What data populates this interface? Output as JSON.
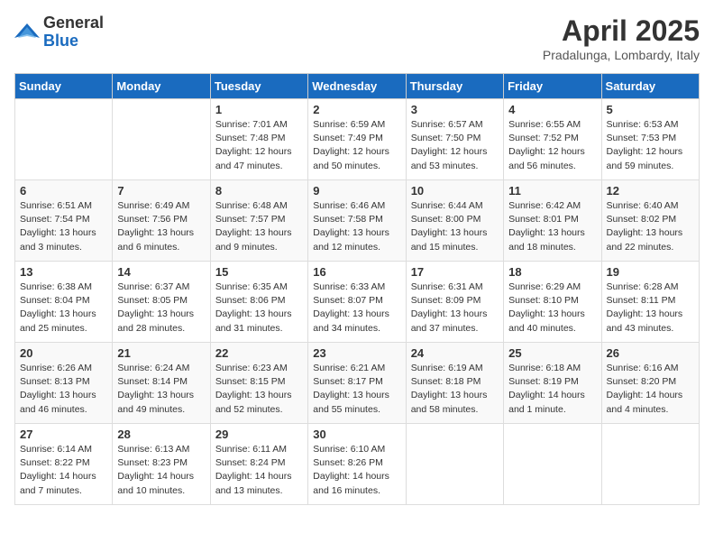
{
  "logo": {
    "general": "General",
    "blue": "Blue"
  },
  "title": "April 2025",
  "subtitle": "Pradalunga, Lombardy, Italy",
  "days_header": [
    "Sunday",
    "Monday",
    "Tuesday",
    "Wednesday",
    "Thursday",
    "Friday",
    "Saturday"
  ],
  "weeks": [
    [
      {
        "day": "",
        "sunrise": "",
        "sunset": "",
        "daylight": ""
      },
      {
        "day": "",
        "sunrise": "",
        "sunset": "",
        "daylight": ""
      },
      {
        "day": "1",
        "sunrise": "Sunrise: 7:01 AM",
        "sunset": "Sunset: 7:48 PM",
        "daylight": "Daylight: 12 hours and 47 minutes."
      },
      {
        "day": "2",
        "sunrise": "Sunrise: 6:59 AM",
        "sunset": "Sunset: 7:49 PM",
        "daylight": "Daylight: 12 hours and 50 minutes."
      },
      {
        "day": "3",
        "sunrise": "Sunrise: 6:57 AM",
        "sunset": "Sunset: 7:50 PM",
        "daylight": "Daylight: 12 hours and 53 minutes."
      },
      {
        "day": "4",
        "sunrise": "Sunrise: 6:55 AM",
        "sunset": "Sunset: 7:52 PM",
        "daylight": "Daylight: 12 hours and 56 minutes."
      },
      {
        "day": "5",
        "sunrise": "Sunrise: 6:53 AM",
        "sunset": "Sunset: 7:53 PM",
        "daylight": "Daylight: 12 hours and 59 minutes."
      }
    ],
    [
      {
        "day": "6",
        "sunrise": "Sunrise: 6:51 AM",
        "sunset": "Sunset: 7:54 PM",
        "daylight": "Daylight: 13 hours and 3 minutes."
      },
      {
        "day": "7",
        "sunrise": "Sunrise: 6:49 AM",
        "sunset": "Sunset: 7:56 PM",
        "daylight": "Daylight: 13 hours and 6 minutes."
      },
      {
        "day": "8",
        "sunrise": "Sunrise: 6:48 AM",
        "sunset": "Sunset: 7:57 PM",
        "daylight": "Daylight: 13 hours and 9 minutes."
      },
      {
        "day": "9",
        "sunrise": "Sunrise: 6:46 AM",
        "sunset": "Sunset: 7:58 PM",
        "daylight": "Daylight: 13 hours and 12 minutes."
      },
      {
        "day": "10",
        "sunrise": "Sunrise: 6:44 AM",
        "sunset": "Sunset: 8:00 PM",
        "daylight": "Daylight: 13 hours and 15 minutes."
      },
      {
        "day": "11",
        "sunrise": "Sunrise: 6:42 AM",
        "sunset": "Sunset: 8:01 PM",
        "daylight": "Daylight: 13 hours and 18 minutes."
      },
      {
        "day": "12",
        "sunrise": "Sunrise: 6:40 AM",
        "sunset": "Sunset: 8:02 PM",
        "daylight": "Daylight: 13 hours and 22 minutes."
      }
    ],
    [
      {
        "day": "13",
        "sunrise": "Sunrise: 6:38 AM",
        "sunset": "Sunset: 8:04 PM",
        "daylight": "Daylight: 13 hours and 25 minutes."
      },
      {
        "day": "14",
        "sunrise": "Sunrise: 6:37 AM",
        "sunset": "Sunset: 8:05 PM",
        "daylight": "Daylight: 13 hours and 28 minutes."
      },
      {
        "day": "15",
        "sunrise": "Sunrise: 6:35 AM",
        "sunset": "Sunset: 8:06 PM",
        "daylight": "Daylight: 13 hours and 31 minutes."
      },
      {
        "day": "16",
        "sunrise": "Sunrise: 6:33 AM",
        "sunset": "Sunset: 8:07 PM",
        "daylight": "Daylight: 13 hours and 34 minutes."
      },
      {
        "day": "17",
        "sunrise": "Sunrise: 6:31 AM",
        "sunset": "Sunset: 8:09 PM",
        "daylight": "Daylight: 13 hours and 37 minutes."
      },
      {
        "day": "18",
        "sunrise": "Sunrise: 6:29 AM",
        "sunset": "Sunset: 8:10 PM",
        "daylight": "Daylight: 13 hours and 40 minutes."
      },
      {
        "day": "19",
        "sunrise": "Sunrise: 6:28 AM",
        "sunset": "Sunset: 8:11 PM",
        "daylight": "Daylight: 13 hours and 43 minutes."
      }
    ],
    [
      {
        "day": "20",
        "sunrise": "Sunrise: 6:26 AM",
        "sunset": "Sunset: 8:13 PM",
        "daylight": "Daylight: 13 hours and 46 minutes."
      },
      {
        "day": "21",
        "sunrise": "Sunrise: 6:24 AM",
        "sunset": "Sunset: 8:14 PM",
        "daylight": "Daylight: 13 hours and 49 minutes."
      },
      {
        "day": "22",
        "sunrise": "Sunrise: 6:23 AM",
        "sunset": "Sunset: 8:15 PM",
        "daylight": "Daylight: 13 hours and 52 minutes."
      },
      {
        "day": "23",
        "sunrise": "Sunrise: 6:21 AM",
        "sunset": "Sunset: 8:17 PM",
        "daylight": "Daylight: 13 hours and 55 minutes."
      },
      {
        "day": "24",
        "sunrise": "Sunrise: 6:19 AM",
        "sunset": "Sunset: 8:18 PM",
        "daylight": "Daylight: 13 hours and 58 minutes."
      },
      {
        "day": "25",
        "sunrise": "Sunrise: 6:18 AM",
        "sunset": "Sunset: 8:19 PM",
        "daylight": "Daylight: 14 hours and 1 minute."
      },
      {
        "day": "26",
        "sunrise": "Sunrise: 6:16 AM",
        "sunset": "Sunset: 8:20 PM",
        "daylight": "Daylight: 14 hours and 4 minutes."
      }
    ],
    [
      {
        "day": "27",
        "sunrise": "Sunrise: 6:14 AM",
        "sunset": "Sunset: 8:22 PM",
        "daylight": "Daylight: 14 hours and 7 minutes."
      },
      {
        "day": "28",
        "sunrise": "Sunrise: 6:13 AM",
        "sunset": "Sunset: 8:23 PM",
        "daylight": "Daylight: 14 hours and 10 minutes."
      },
      {
        "day": "29",
        "sunrise": "Sunrise: 6:11 AM",
        "sunset": "Sunset: 8:24 PM",
        "daylight": "Daylight: 14 hours and 13 minutes."
      },
      {
        "day": "30",
        "sunrise": "Sunrise: 6:10 AM",
        "sunset": "Sunset: 8:26 PM",
        "daylight": "Daylight: 14 hours and 16 minutes."
      },
      {
        "day": "",
        "sunrise": "",
        "sunset": "",
        "daylight": ""
      },
      {
        "day": "",
        "sunrise": "",
        "sunset": "",
        "daylight": ""
      },
      {
        "day": "",
        "sunrise": "",
        "sunset": "",
        "daylight": ""
      }
    ]
  ]
}
